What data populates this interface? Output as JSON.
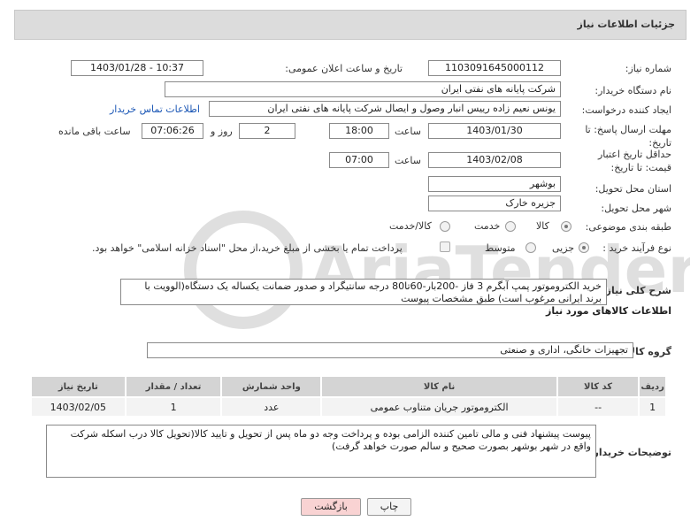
{
  "header": {
    "title": "جزئیات اطلاعات نیاز"
  },
  "need_number": {
    "label": "شماره نیاز:",
    "value": "1103091645000112"
  },
  "announce": {
    "label": "تاریخ و ساعت اعلان عمومی:",
    "value": "1403/01/28 - 10:37"
  },
  "buyer_org": {
    "label": "نام دستگاه خریدار:",
    "value": "شرکت پایانه های نفتی ایران"
  },
  "creator": {
    "label": "ایجاد کننده درخواست:",
    "value": "یونس نعیم زاده رییس انبار وصول و ایصال شرکت پایانه های نفتی ایران",
    "contact_link": "اطلاعات تماس خریدار"
  },
  "deadline": {
    "label": "مهلت ارسال پاسخ: تا تاریخ:",
    "date": "1403/01/30",
    "time_label": "ساعت",
    "time": "18:00",
    "days": "2",
    "days_label": "روز و",
    "remaining": "07:06:26",
    "remaining_label": "ساعت باقی مانده"
  },
  "validity": {
    "label": "حداقل تاریخ اعتبار قیمت: تا تاریخ:",
    "date": "1403/02/08",
    "time_label": "ساعت",
    "time": "07:00"
  },
  "province": {
    "label": "استان محل تحویل:",
    "value": "بوشهر"
  },
  "city": {
    "label": "شهر محل تحویل:",
    "value": "جزیره خارک"
  },
  "category": {
    "label": "طبقه بندی موضوعی:",
    "options": [
      "کالا",
      "خدمت",
      "کالا/خدمت"
    ],
    "selected": "کالا"
  },
  "process": {
    "label": "نوع فرآیند خرید :",
    "options": [
      "جزیی",
      "متوسط"
    ],
    "selected": "جزیی",
    "payment_note": "پرداخت تمام یا بخشی از مبلغ خرید،از محل \"اسناد خزانه اسلامی\" خواهد بود."
  },
  "description": {
    "label": "شرح کلی نیاز:",
    "value": "خرید الکتروموتور پمپ آبگرم 3 فاز -200بار-60تا80 درجه سانتیگراد و صدور ضمانت یکساله یک دستگاه(الوویت با برند ایرانی مرغوب است) طبق مشخصات پیوست"
  },
  "goods_info": {
    "title": "اطلاعات کالاهای مورد نیاز"
  },
  "goods_group": {
    "label": "گروه کالا:",
    "value": "تجهیزات خانگی، اداری و صنعتی"
  },
  "table": {
    "headers": [
      "ردیف",
      "کد کالا",
      "نام کالا",
      "واحد شمارش",
      "تعداد / مقدار",
      "تاریخ نیاز"
    ],
    "rows": [
      [
        "1",
        "--",
        "الکتروموتور جریان متناوب عمومی",
        "عدد",
        "1",
        "1403/02/05"
      ]
    ]
  },
  "buyer_notes": {
    "label": "توضیحات خریدار:",
    "value": "پیوست پیشنهاد فنی و مالی تامین کننده الزامی بوده و پرداخت وجه دو ماه پس از تحویل و تایید کالا(تحویل کالا درب اسکله شرکت واقع در شهر بوشهر بصورت صحیح و سالم صورت خواهد گرفت)"
  },
  "buttons": {
    "print": "چاپ",
    "back": "بازگشت"
  },
  "colors": {
    "header_bg": "#dcdcdc",
    "link": "#1a56b5",
    "back_button_bg": "#f9d3d3",
    "print_button_bg": "#f4f4f4"
  }
}
